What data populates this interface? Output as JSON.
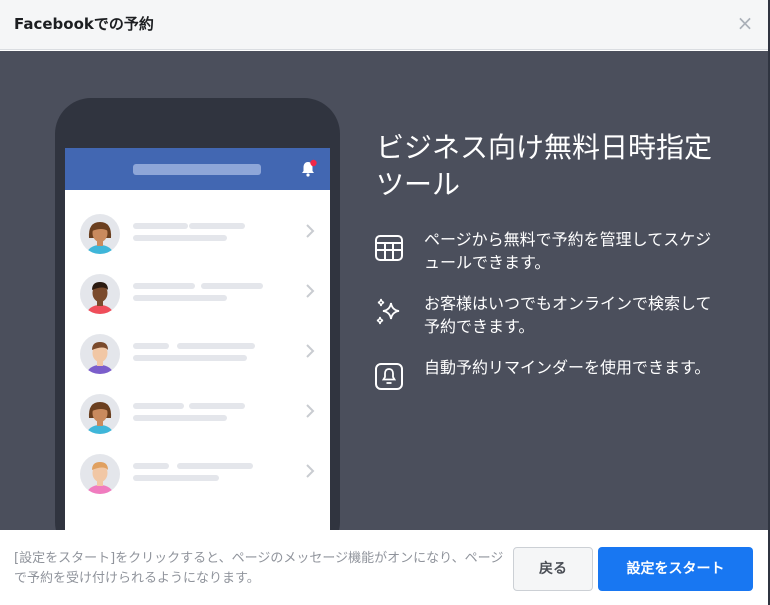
{
  "dialog": {
    "title": "Facebookでの予約",
    "close_label": "×"
  },
  "hero": {
    "title": "ビジネス向け無料日時指定ツール",
    "features": [
      {
        "icon": "calendar-grid-icon",
        "text": "ページから無料で予約を管理してスケジュールできます。"
      },
      {
        "icon": "sparkles-icon",
        "text": "お客様はいつでもオンラインで検索して予約できます。"
      },
      {
        "icon": "bell-icon",
        "text": "自動予約リマインダーを使用できます。"
      }
    ]
  },
  "phone_mock": {
    "notification_badge_color": "#f02849",
    "rows": [
      {
        "avatar": "woman-avatar-icon",
        "skin": "#c98a5e",
        "hair": "#6b3f1f",
        "shirt": "#3fb6d9"
      },
      {
        "avatar": "man-avatar-icon",
        "skin": "#7a4a2c",
        "hair": "#2b1a10",
        "shirt": "#ef4d5a"
      },
      {
        "avatar": "man-avatar-icon",
        "skin": "#f1c7a5",
        "hair": "#7a4a2c",
        "shirt": "#7b5ecb"
      },
      {
        "avatar": "woman-avatar-icon",
        "skin": "#c98a5e",
        "hair": "#6b3f1f",
        "shirt": "#3fb6d9"
      },
      {
        "avatar": "man-avatar-icon",
        "skin": "#f1c7a5",
        "hair": "#e0a060",
        "shirt": "#f07cbf"
      }
    ]
  },
  "footer": {
    "note": "[設定をスタート]をクリックすると、ページのメッセージ機能がオンになり、ページで予約を受け付けられるようになります。",
    "back_label": "戻る",
    "start_label": "設定をスタート"
  },
  "colors": {
    "accent": "#1877f2",
    "hero_bg": "#4b4f5c",
    "facebook_blue": "#4267b2"
  }
}
